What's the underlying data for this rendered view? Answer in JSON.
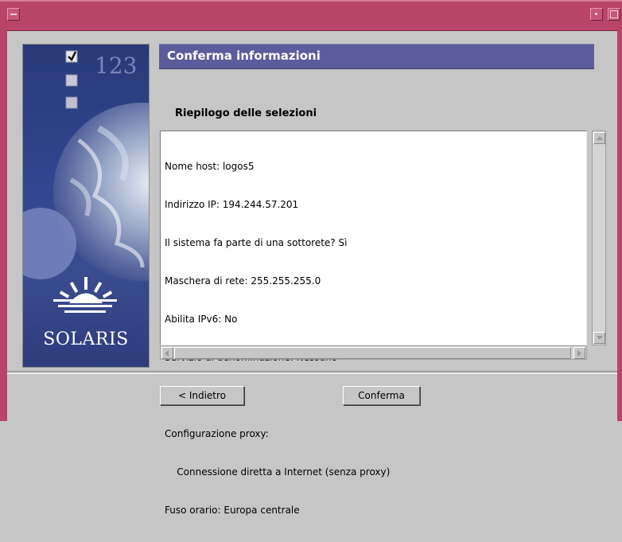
{
  "window": {
    "title": "",
    "title_bar_color": "#b8446a"
  },
  "side_panel": {
    "counter_text": "123",
    "logo_text": "SOLARIS",
    "logo_mark": "sun-rays-icon"
  },
  "header": {
    "title": "Conferma informazioni",
    "color": "#5c5c9c"
  },
  "summary": {
    "title": "Riepilogo delle selezioni",
    "lines": [
      "Nome host: logos5",
      "Indirizzo IP: 194.244.57.201",
      "Il sistema fa parte di una sottorete? Sì",
      "Maschera di rete: 255.255.255.0",
      "Abilita IPv6: No",
      "Servizio di denominazione: Nessuno",
      "",
      "Configurazione proxy:",
      "    Connessione diretta a Internet (senza proxy)",
      "Fuso orario: Europa centrale"
    ]
  },
  "buttons": {
    "back": "< Indietro",
    "confirm": "Conferma"
  }
}
